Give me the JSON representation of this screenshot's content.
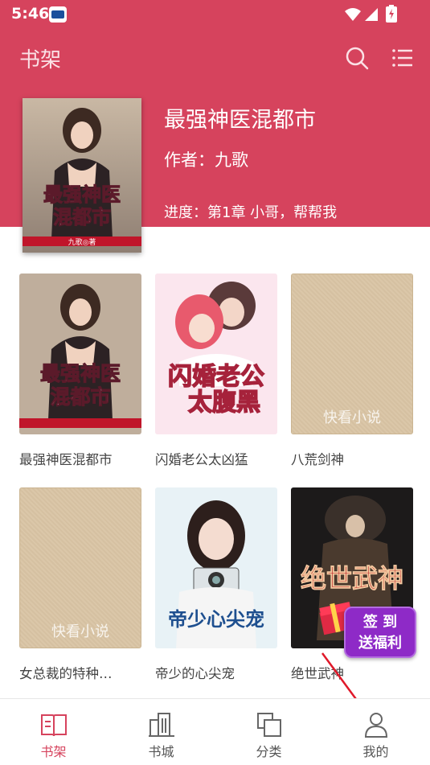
{
  "status_bar": {
    "time": "5:46"
  },
  "appbar": {
    "title": "书架",
    "icons": [
      "search-icon",
      "menu-icon"
    ]
  },
  "featured": {
    "title": "最强神医混都市",
    "author": "作者：九歌",
    "progress": "进度：第1章 小哥，帮帮我",
    "cover_text": "最强神医混都市",
    "cover_author": "九歌◎著"
  },
  "books": [
    {
      "title": "最强神医混都市",
      "cover": "image",
      "cover_text": "最强神医混都市"
    },
    {
      "title": "闪婚老公太凶猛",
      "cover": "image",
      "cover_text": "闪婚老公太腹黑"
    },
    {
      "title": "八荒剑神",
      "cover": "placeholder",
      "cover_text": "快看小说"
    },
    {
      "title": "女总裁的特种…",
      "cover": "placeholder",
      "cover_text": "快看小说"
    },
    {
      "title": "帝少的心尖宠",
      "cover": "image",
      "cover_text": "帝少心尖宠"
    },
    {
      "title": "绝世武神",
      "cover": "image",
      "cover_text": "绝世武神"
    }
  ],
  "signin_badge": {
    "line1": "签 到",
    "line2": "送福利"
  },
  "bottom_nav": [
    {
      "label": "书架",
      "icon": "book-open-icon",
      "active": true
    },
    {
      "label": "书城",
      "icon": "buildings-icon",
      "active": false
    },
    {
      "label": "分类",
      "icon": "stack-icon",
      "active": false
    },
    {
      "label": "我的",
      "icon": "person-icon",
      "active": false
    }
  ],
  "colors": {
    "primary": "#d6435d",
    "badge": "#8e2ac7",
    "placeholder": "#d9c4a4"
  }
}
